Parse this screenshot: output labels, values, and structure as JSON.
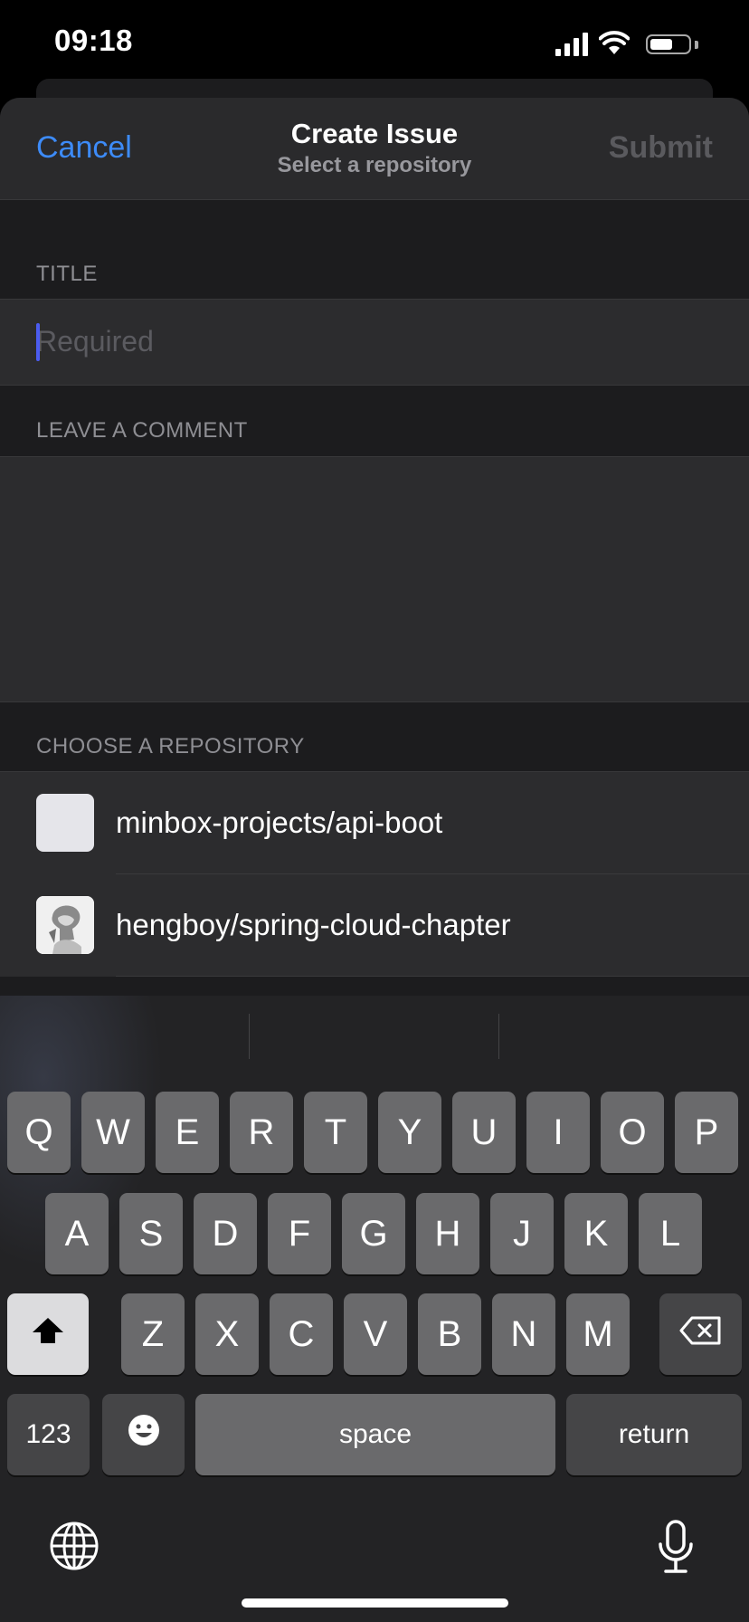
{
  "status_bar": {
    "time": "09:18",
    "battery_level": 0.6
  },
  "nav": {
    "cancel_label": "Cancel",
    "title": "Create Issue",
    "subtitle": "Select a repository",
    "submit_label": "Submit"
  },
  "form": {
    "title_header": "TITLE",
    "title_placeholder": "Required",
    "comment_header": "LEAVE A COMMENT",
    "repo_header": "CHOOSE A REPOSITORY",
    "repositories": [
      {
        "name": "minbox-projects/api-boot"
      },
      {
        "name": "hengboy/spring-cloud-chapter"
      }
    ]
  },
  "keyboard": {
    "row1": [
      "Q",
      "W",
      "E",
      "R",
      "T",
      "Y",
      "U",
      "I",
      "O",
      "P"
    ],
    "row2": [
      "A",
      "S",
      "D",
      "F",
      "G",
      "H",
      "J",
      "K",
      "L"
    ],
    "row3": [
      "Z",
      "X",
      "C",
      "V",
      "B",
      "N",
      "M"
    ],
    "numbers_label": "123",
    "space_label": "space",
    "return_label": "return",
    "icons": {
      "shift": "shift-icon",
      "delete": "delete-icon",
      "emoji": "emoji-icon",
      "globe": "globe-icon",
      "mic": "microphone-icon"
    }
  }
}
